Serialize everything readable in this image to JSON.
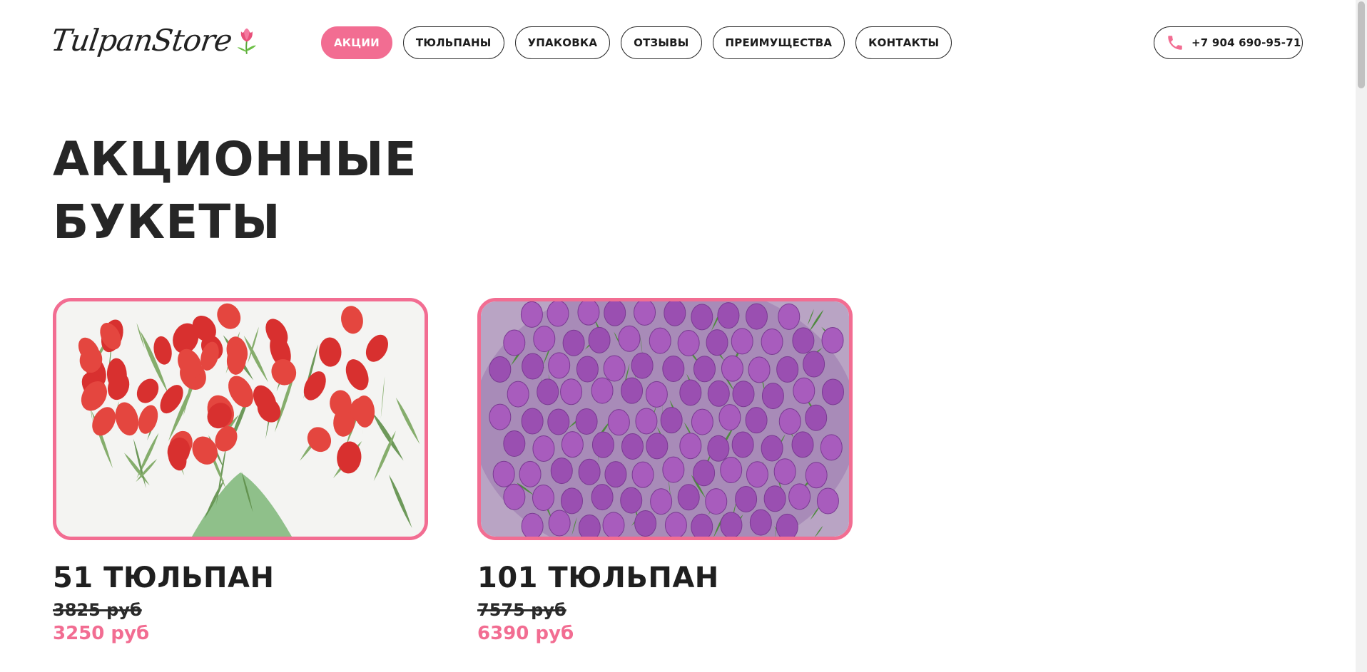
{
  "logo": {
    "text": "TulpanStore"
  },
  "nav": {
    "items": [
      {
        "label": "АКЦИИ"
      },
      {
        "label": "ТЮЛЬПАНЫ"
      },
      {
        "label": "УПАКОВКА"
      },
      {
        "label": "ОТЗЫВЫ"
      },
      {
        "label": "ПРЕИМУЩЕСТВА"
      },
      {
        "label": "КОНТАКТЫ"
      }
    ],
    "active_index": 0
  },
  "phone": {
    "number": "+7 904 690-95-71",
    "icon": "phone-icon"
  },
  "section": {
    "title_line1": "АКЦИОННЫЕ",
    "title_line2": "БУКЕТЫ"
  },
  "products": [
    {
      "name": "51 ТЮЛЬПАН",
      "old_price": "3825 руб",
      "new_price": "3250 руб",
      "image": "red-tulips-bouquet"
    },
    {
      "name": "101 ТЮЛЬПАН",
      "old_price": "7575 руб",
      "new_price": "6390 руб",
      "image": "purple-tulips-bouquet"
    }
  ],
  "colors": {
    "accent": "#f26d92",
    "text": "#1f1f1f",
    "background": "#ffffff"
  }
}
